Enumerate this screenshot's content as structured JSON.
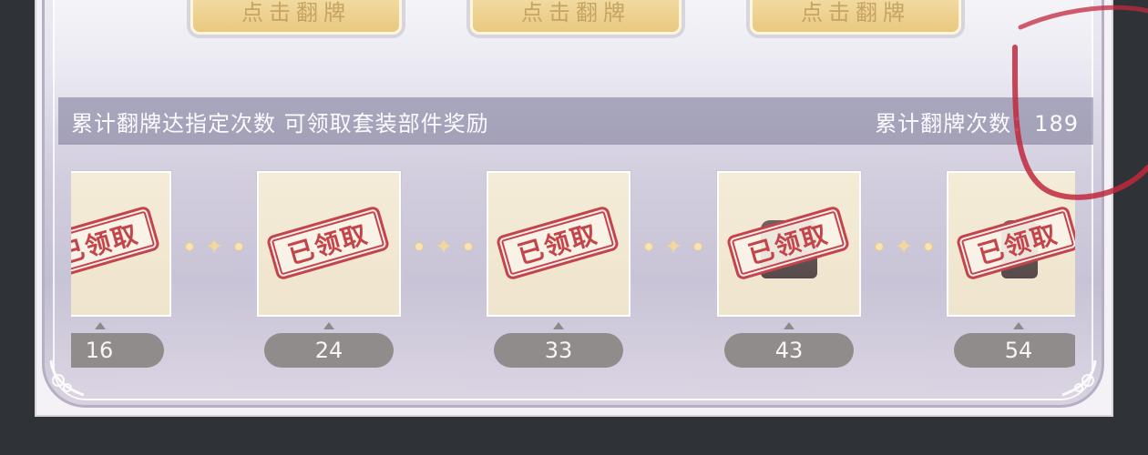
{
  "flip_buttons": [
    {
      "label": "点击翻牌"
    },
    {
      "label": "点击翻牌"
    },
    {
      "label": "点击翻牌"
    }
  ],
  "info_bar": {
    "hint": "累计翻牌达指定次数 可领取套装部件奖励",
    "count_label": "累计翻牌次数：189"
  },
  "rewards": [
    {
      "threshold": "16",
      "status": "已领取"
    },
    {
      "threshold": "24",
      "status": "已领取"
    },
    {
      "threshold": "33",
      "status": "已领取"
    },
    {
      "threshold": "43",
      "status": "已领取"
    },
    {
      "threshold": "54",
      "status": "已领取"
    }
  ],
  "colors": {
    "stamp_red": "#c3454a",
    "badge_gray": "#8f8c8b",
    "button_gold": "#e9c97f",
    "scribble_red": "#c0283c"
  },
  "icons": [
    "sparkle-connector-icon",
    "corner-ornament-icon"
  ]
}
